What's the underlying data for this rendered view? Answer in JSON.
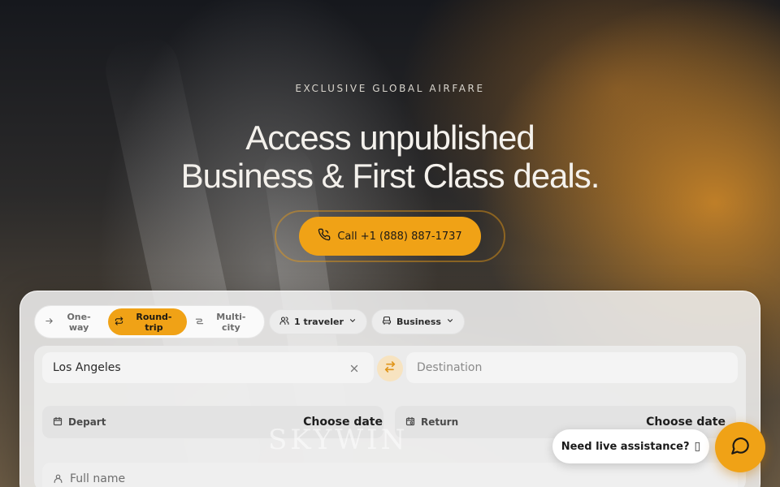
{
  "hero": {
    "eyebrow": "EXCLUSIVE GLOBAL AIRFARE",
    "headline_line1": "Access unpublished",
    "headline_line2": "Business & First Class deals.",
    "call_label": "Call +1 (888) 887-1737"
  },
  "search": {
    "trip_types": [
      {
        "label": "One-way",
        "icon": "arrow-right-icon",
        "active": false
      },
      {
        "label": "Round-trip",
        "icon": "repeat-icon",
        "active": true
      },
      {
        "label": "Multi-city",
        "icon": "route-icon",
        "active": false
      }
    ],
    "travelers_label": "1 traveler",
    "cabin_label": "Business",
    "origin_value": "Los Angeles",
    "destination_placeholder": "Destination",
    "depart_label": "Depart",
    "depart_value": "Choose date",
    "return_label": "Return",
    "return_value": "Choose date",
    "full_name_placeholder": "Full name",
    "watermark": "SKYWIN"
  },
  "chat": {
    "assist_label": "Need live assistance?",
    "close_glyph": "▯"
  },
  "colors": {
    "accent": "#f0a216",
    "panel_bg": "#f2f2f2"
  }
}
